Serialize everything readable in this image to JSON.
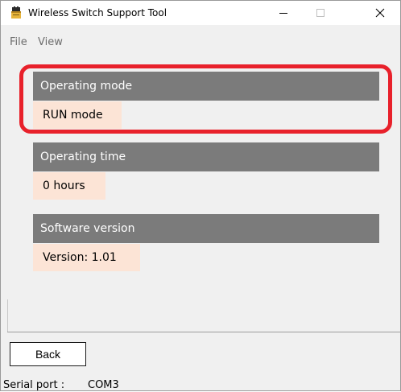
{
  "window": {
    "title": "Wireless Switch Support Tool",
    "icon": "battery-plug-icon",
    "controls": {
      "minimize": "minimize-icon",
      "maximize": "maximize-icon",
      "close": "close-icon"
    }
  },
  "menubar": {
    "file": "File",
    "view": "View"
  },
  "panels": [
    {
      "header": "Operating mode",
      "value": "RUN mode"
    },
    {
      "header": "Operating time",
      "value": "0 hours"
    },
    {
      "header": "Software version",
      "value": "Version: 1.01"
    }
  ],
  "colors": {
    "panel_header_bg": "#7b7b7b",
    "panel_value_bg": "#fce4d6",
    "highlight": "#e8212b"
  },
  "footer": {
    "back_label": "Back",
    "serial_port_label": "Serial port :",
    "serial_port_value": "COM3"
  }
}
